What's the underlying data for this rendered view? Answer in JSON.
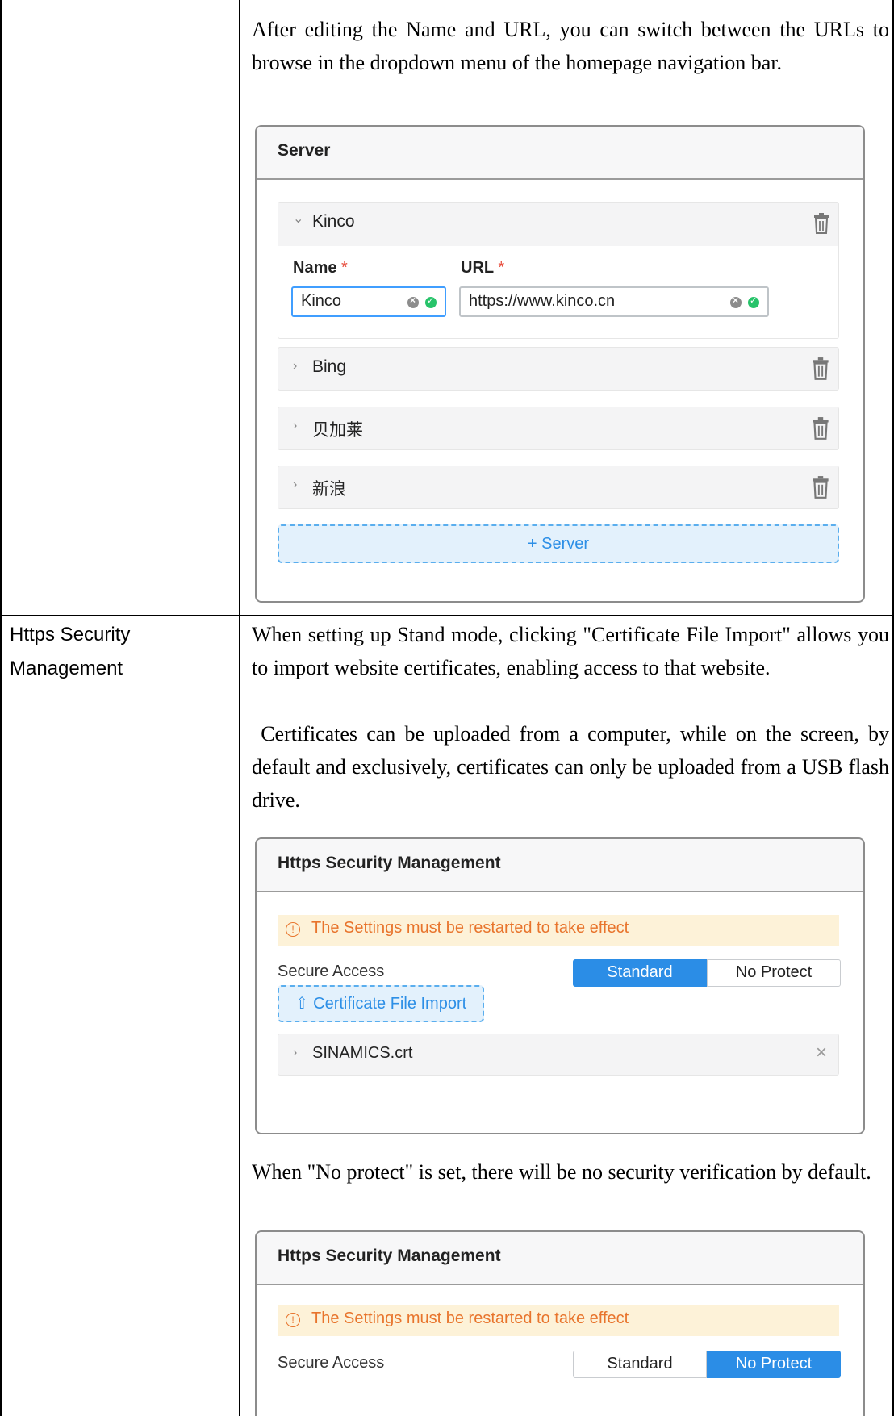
{
  "row1": {
    "description": "After editing the Name and URL, you can switch between the URLs to browse in the dropdown menu of the homepage navigation bar.",
    "server_panel": {
      "title": "Server",
      "servers": [
        {
          "name": "Kinco",
          "chevron": "⌄"
        },
        {
          "name": "Bing",
          "chevron": "›"
        },
        {
          "name": "贝加莱",
          "chevron": "›"
        },
        {
          "name": "新浪",
          "chevron": "›"
        }
      ],
      "name_label": "Name",
      "url_label": "URL",
      "required_mark": "*",
      "name_value": "Kinco",
      "url_value": "https://www.kinco.cn",
      "add_button": "+ Server",
      "trash_icon": "trash-icon"
    }
  },
  "row2": {
    "label_line1": "Https Security",
    "label_line2": "Management",
    "desc1": "When setting up Stand mode, clicking \"Certificate File Import\" allows you to import website certificates, enabling access to that website.",
    "desc2": " Certificates can be uploaded from a computer, while on the screen, by default and exclusively, certificates can only be uploaded from a USB flash drive.",
    "desc3": "When \"No protect\" is set, there will be no security verification by default.",
    "panel1": {
      "title": "Https Security Management",
      "warning": "The Settings must be restarted to take effect",
      "secure_access": "Secure Access",
      "standard": "Standard",
      "no_protect": "No Protect",
      "selected": "Standard",
      "import_button": "⇧ Certificate File Import",
      "certificate": "SINAMICS.crt"
    },
    "panel2": {
      "title": "Https Security Management",
      "warning": "The Settings must be restarted to take effect",
      "secure_access": "Secure Access",
      "standard": "Standard",
      "no_protect": "No Protect",
      "selected": "No Protect"
    }
  },
  "colors": {
    "accent": "#2b8de6",
    "warning": "#e8742c",
    "success": "#27c36a"
  }
}
